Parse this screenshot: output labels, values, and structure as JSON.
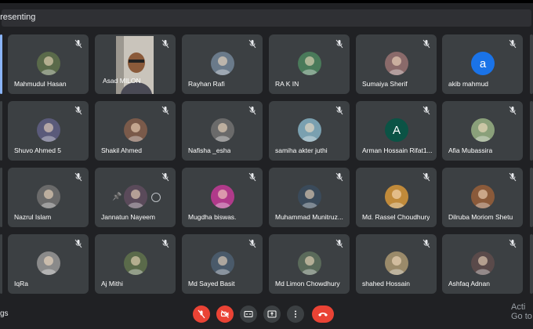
{
  "header": {
    "presenting_text": "presenting"
  },
  "participants": [
    {
      "name": "Mahmudul Hasan"
    },
    {
      "name": "Asad MILON"
    },
    {
      "name": "Rayhan Rafi"
    },
    {
      "name": "RA K IN"
    },
    {
      "name": "Sumaiya Sherif"
    },
    {
      "name": "akib mahmud",
      "letter": "a"
    },
    {
      "name": "Shuvo Ahmed 5"
    },
    {
      "name": "Shakil Ahmed"
    },
    {
      "name": "Nafisha _esha"
    },
    {
      "name": "samiha akter juthi"
    },
    {
      "name": "Arman Hossain Rifat1...",
      "letter": "A"
    },
    {
      "name": "Afia Mubassira"
    },
    {
      "name": "Nazrul Islam"
    },
    {
      "name": "Jannatun Nayeem"
    },
    {
      "name": "Mugdha biswas."
    },
    {
      "name": "Muhammad Munitruz..."
    },
    {
      "name": "Md. Rassel Choudhury"
    },
    {
      "name": "Dilruba Moriom Shetu"
    },
    {
      "name": "IqRa"
    },
    {
      "name": "Aj Mithi"
    },
    {
      "name": "Md Sayed Basit"
    },
    {
      "name": "Md Limon Chowdhury"
    },
    {
      "name": "shahed Hossain"
    },
    {
      "name": "Ashfaq Adnan"
    }
  ],
  "footer": {
    "side_text": "gs",
    "watermark_line1": "Acti",
    "watermark_line2": "Go to"
  },
  "colors": {
    "tile": "#3c4043",
    "background": "#202124",
    "red": "#ea4335",
    "letter_blue": "#1a73e8",
    "letter_green": "#0b5345"
  }
}
